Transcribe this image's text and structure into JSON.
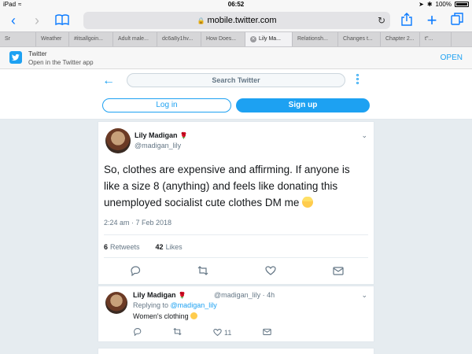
{
  "statusbar": {
    "device": "iPad",
    "time": "06:52",
    "battery": "100%"
  },
  "browser": {
    "url": "mobile.twitter.com"
  },
  "tabs": [
    {
      "label": "Sr",
      "active": false
    },
    {
      "label": "Weather",
      "active": false
    },
    {
      "label": "#itsallgoin...",
      "active": false
    },
    {
      "label": "Adult male...",
      "active": false
    },
    {
      "label": "dc6a8y1hv...",
      "active": false
    },
    {
      "label": "How Does...",
      "active": false
    },
    {
      "label": "Lily Ma...",
      "active": true
    },
    {
      "label": "Relationsh...",
      "active": false
    },
    {
      "label": "Changes t...",
      "active": false
    },
    {
      "label": "Chapter 2...",
      "active": false
    },
    {
      "label": "t\"...",
      "active": false
    }
  ],
  "banner": {
    "title": "Twitter",
    "subtitle": "Open in the Twitter app",
    "open_label": "OPEN"
  },
  "header": {
    "search_placeholder": "Search Twitter",
    "login_label": "Log in",
    "signup_label": "Sign up"
  },
  "tweet": {
    "name": "Lily Madigan",
    "handle": "@madigan_lily",
    "text": "So, clothes are expensive and affirming. If anyone is like a size 8 (anything) and feels like donating this unemployed socialist cute clothes DM me",
    "timestamp": "2:24 am · 7 Feb 2018",
    "retweets": "6",
    "retweets_label": "Retweets",
    "likes": "42",
    "likes_label": "Likes"
  },
  "reply": {
    "name": "Lily Madigan",
    "handle": "@madigan_lily · 4h",
    "replying_prefix": "Replying to",
    "replying_to": "@madigan_lily",
    "text": "Women's clothing",
    "like_count": "11"
  },
  "colors": {
    "accent": "#1da1f2",
    "rose": "#b5121b"
  }
}
